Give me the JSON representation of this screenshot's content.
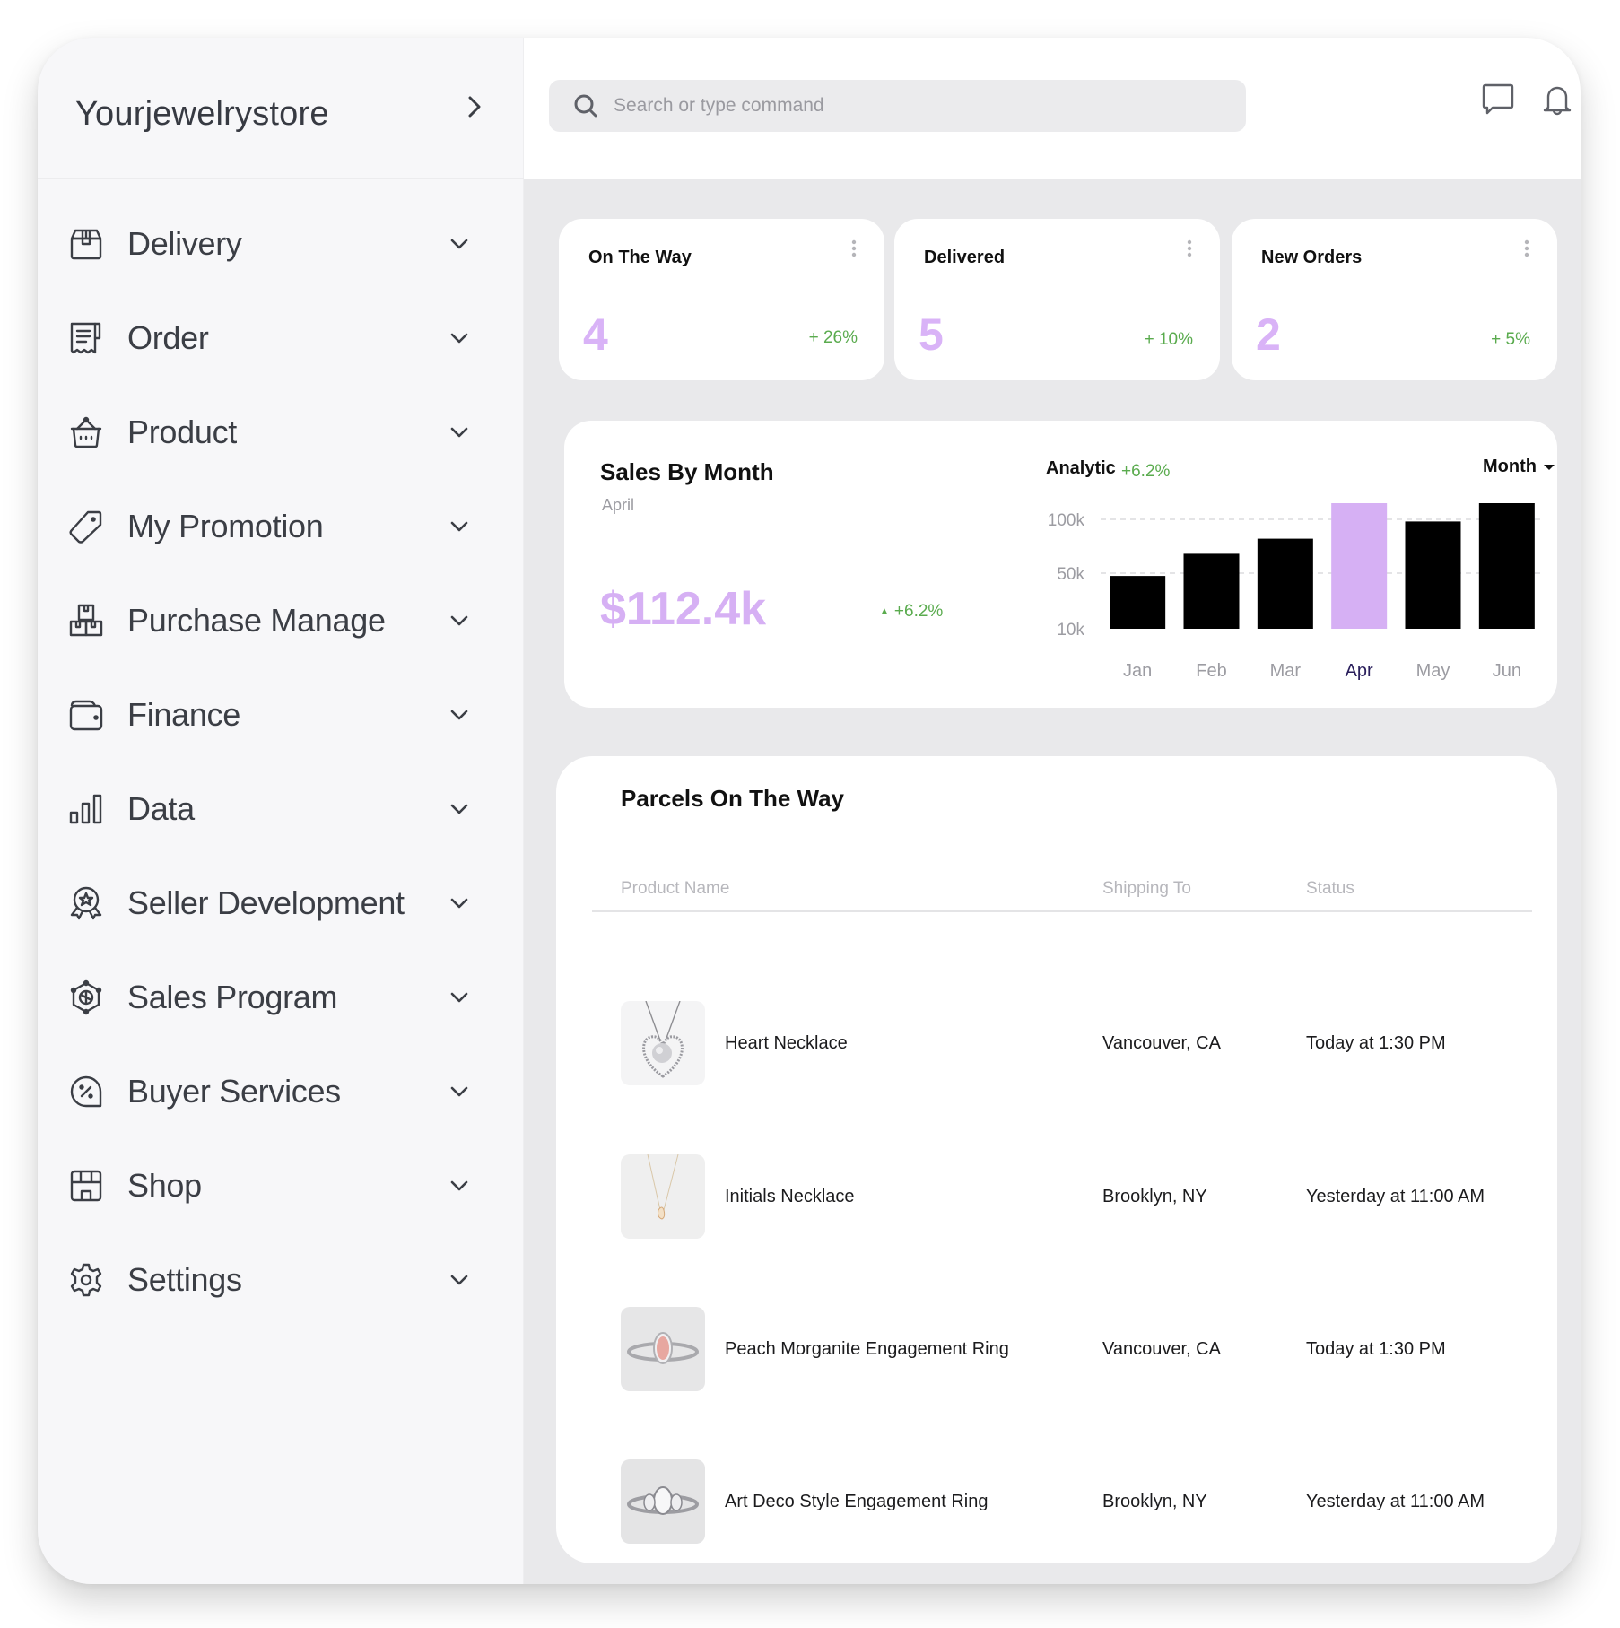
{
  "brand": {
    "name": "Yourjewelrystore",
    "toggle_icon": "chevron-right-icon"
  },
  "sidebar": {
    "items": [
      {
        "label": "Delivery",
        "icon": "delivery-box-icon"
      },
      {
        "label": "Order",
        "icon": "receipt-icon"
      },
      {
        "label": "Product",
        "icon": "basket-icon"
      },
      {
        "label": "My Promotion",
        "icon": "tag-icon"
      },
      {
        "label": "Purchase Manage",
        "icon": "stacked-boxes-icon"
      },
      {
        "label": "Finance",
        "icon": "wallet-icon"
      },
      {
        "label": "Data",
        "icon": "bar-chart-icon"
      },
      {
        "label": "Seller Development",
        "icon": "award-badge-icon"
      },
      {
        "label": "Sales Program",
        "icon": "hexagon-program-icon"
      },
      {
        "label": "Buyer Services",
        "icon": "discount-chat-icon"
      },
      {
        "label": "Shop",
        "icon": "storefront-icon"
      },
      {
        "label": "Settings",
        "icon": "gear-icon"
      }
    ]
  },
  "header": {
    "search": {
      "placeholder": "Search or type command",
      "value": ""
    },
    "icons": [
      "chat-icon",
      "bell-icon"
    ]
  },
  "stats": [
    {
      "title": "On The Way",
      "value": "4",
      "change": "+ 26%"
    },
    {
      "title": "Delivered",
      "value": "5",
      "change": "+ 10%"
    },
    {
      "title": "New Orders",
      "value": "2",
      "change": "+ 5%"
    }
  ],
  "sales": {
    "title": "Sales By Month",
    "subtitle": "April",
    "amount": "$112.4k",
    "change": "+6.2%",
    "analytic_label": "Analytic",
    "analytic_change": "+6.2%",
    "period": "Month"
  },
  "chart_data": {
    "type": "bar",
    "title": "Analytic",
    "categories": [
      "Jan",
      "Feb",
      "Mar",
      "Apr",
      "May",
      "Jun"
    ],
    "values": [
      48,
      68,
      82,
      115,
      98,
      115
    ],
    "units": "k",
    "highlight": "Apr",
    "yticks": [
      10,
      50,
      100
    ],
    "ytick_labels": [
      "10k",
      "50k",
      "100k"
    ],
    "ylim": [
      10,
      115
    ],
    "grid": "dashed horizontal at 50k and 100k",
    "xlabel": "",
    "ylabel": "",
    "colors": {
      "bar": "#000000",
      "highlight": "#d6b0f4",
      "highlight_label": "#2a1f5c",
      "tick": "#9c9ca2"
    }
  },
  "parcels": {
    "title": "Parcels On The Way",
    "columns": [
      "Product Name",
      "Shipping To",
      "Status"
    ],
    "rows": [
      {
        "product": "Heart Necklace",
        "shipping_to": "Vancouver, CA",
        "status": "Today at 1:30 PM",
        "thumb": "heart-necklace-image"
      },
      {
        "product": "Initials Necklace",
        "shipping_to": "Brooklyn, NY",
        "status": "Yesterday at 11:00 AM",
        "thumb": "initials-necklace-image"
      },
      {
        "product": "Peach Morganite Engagement Ring",
        "shipping_to": "Vancouver, CA",
        "status": "Today at 1:30 PM",
        "thumb": "morganite-ring-image"
      },
      {
        "product": "Art Deco Style Engagement Ring",
        "shipping_to": "Brooklyn, NY",
        "status": "Yesterday at 11:00 AM",
        "thumb": "art-deco-ring-image"
      }
    ]
  },
  "colors": {
    "accent_purple": "#d6b0f4",
    "positive_green": "#5aab4e",
    "sidebar_bg": "#f7f7f9",
    "content_bg": "#e9e9eb"
  }
}
